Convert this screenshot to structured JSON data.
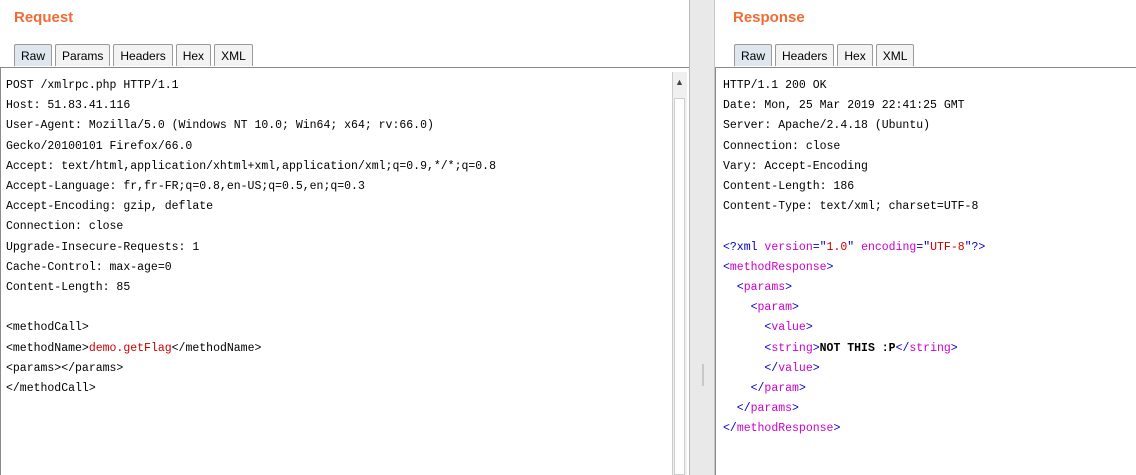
{
  "request": {
    "title": "Request",
    "tabs": [
      {
        "label": "Raw"
      },
      {
        "label": "Params"
      },
      {
        "label": "Headers"
      },
      {
        "label": "Hex"
      },
      {
        "label": "XML"
      }
    ],
    "lines": {
      "l1": "POST /xmlrpc.php HTTP/1.1",
      "l2": "Host: 51.83.41.116",
      "l3": "User-Agent: Mozilla/5.0 (Windows NT 10.0; Win64; x64; rv:66.0)",
      "l4": "Gecko/20100101 Firefox/66.0",
      "l5": "Accept: text/html,application/xhtml+xml,application/xml;q=0.9,*/*;q=0.8",
      "l6": "Accept-Language: fr,fr-FR;q=0.8,en-US;q=0.5,en;q=0.3",
      "l7": "Accept-Encoding: gzip, deflate",
      "l8": "Connection: close",
      "l9": "Upgrade-Insecure-Requests: 1",
      "l10": "Cache-Control: max-age=0",
      "l11": "Content-Length: 85",
      "l13": "<methodCall>",
      "l14a": "<methodName>",
      "l14b": "demo.getFlag",
      "l14c": "</methodName>",
      "l15": "<params></params>",
      "l16": "</methodCall>"
    }
  },
  "response": {
    "title": "Response",
    "tabs": [
      {
        "label": "Raw"
      },
      {
        "label": "Headers"
      },
      {
        "label": "Hex"
      },
      {
        "label": "XML"
      }
    ],
    "lines": {
      "l1": "HTTP/1.1 200 OK",
      "l2": "Date: Mon, 25 Mar 2019 22:41:25 GMT",
      "l3": "Server: Apache/2.4.18 (Ubuntu)",
      "l4": "Connection: close",
      "l5": "Vary: Accept-Encoding",
      "l6": "Content-Length: 186",
      "l7": "Content-Type: text/xml; charset=UTF-8",
      "x9a": "<?xml ",
      "x9b": "version",
      "x9c": "=\"",
      "x9d": "1.0",
      "x9e": "\" ",
      "x9f": "encoding",
      "x9g": "=\"",
      "x9h": "UTF-8",
      "x9i": "\"?>",
      "x10a": "<",
      "x10b": "methodResponse",
      "x10c": ">",
      "x11a": "  <",
      "x11b": "params",
      "x11c": ">",
      "x12a": "    <",
      "x12b": "param",
      "x12c": ">",
      "x13a": "      <",
      "x13b": "value",
      "x13c": ">",
      "x14a": "      <",
      "x14b": "string",
      "x14c": ">",
      "x14d": "NOT THIS :P",
      "x14e": "</",
      "x14f": "string",
      "x14g": ">",
      "x15a": "      </",
      "x15b": "value",
      "x15c": ">",
      "x16a": "    </",
      "x16b": "param",
      "x16c": ">",
      "x17a": "  </",
      "x17b": "params",
      "x17c": ">",
      "x18a": "</",
      "x18b": "methodResponse",
      "x18c": ">"
    }
  },
  "colors": {
    "title": "#f06c37",
    "xml_markup": "#0000cc",
    "xml_tag": "#cc00cc",
    "xml_highlight": "#cc0000"
  },
  "icons": {
    "scroll_up": "scroll-up-arrow-icon"
  }
}
